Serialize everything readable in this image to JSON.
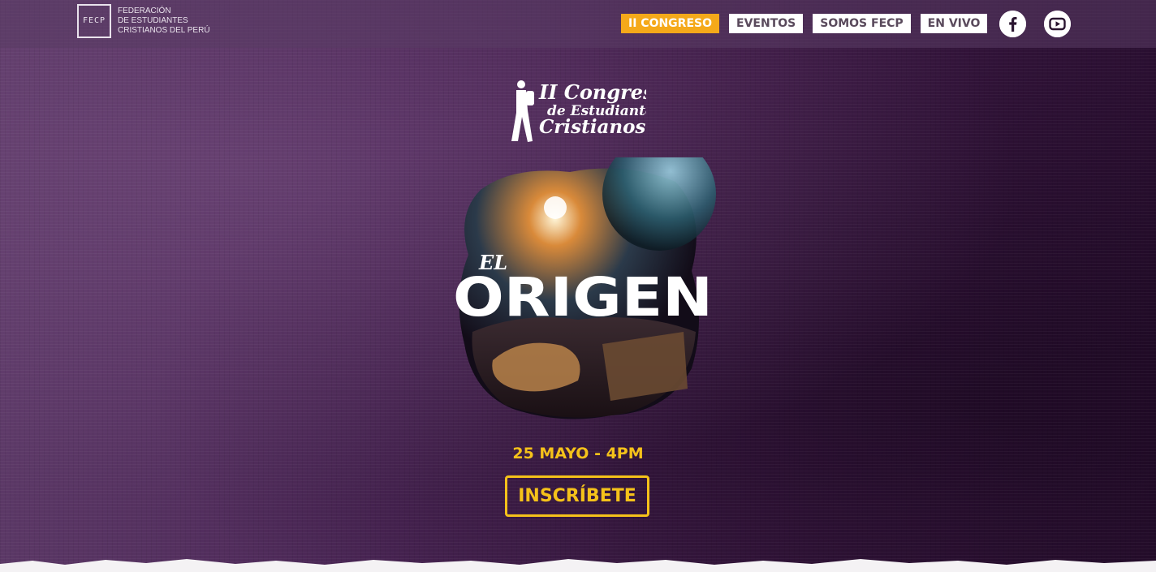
{
  "brand": {
    "mark": "FECP",
    "lines": [
      "FEDERACIÓN",
      "DE ESTUDIANTES",
      "CRISTIANOS DEL PERÚ"
    ]
  },
  "nav": {
    "items": [
      {
        "label": "II CONGRESO",
        "active": true
      },
      {
        "label": "EVENTOS",
        "active": false
      },
      {
        "label": "SOMOS FECP",
        "active": false
      },
      {
        "label": "EN VIVO",
        "active": false
      }
    ]
  },
  "social": {
    "facebook_icon": "facebook-icon",
    "youtube_icon": "youtube-icon"
  },
  "hero": {
    "congress_logo": {
      "line1": "II Congreso",
      "line2": "de Estudiantes",
      "line3": "Cristianos"
    },
    "poster": {
      "small": "EL",
      "title": "ORIGEN"
    },
    "date": "25 MAYO - 4PM",
    "cta": "INSCRÍBETE"
  },
  "colors": {
    "accent": "#f5a91a",
    "cta": "#f5c21a",
    "background": "#3b1a42"
  }
}
